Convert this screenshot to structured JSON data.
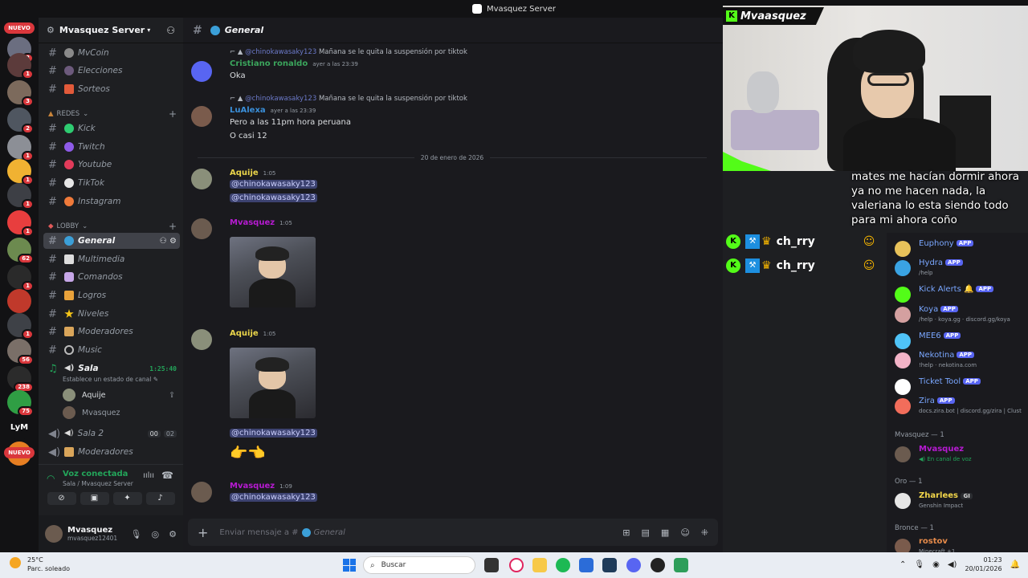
{
  "window_title": "Mvasquez Server",
  "rail": {
    "nuevo_top": "NUEVO",
    "nuevo_bottom": "NUEVO",
    "badges": [
      "3",
      "1",
      "3",
      "2",
      "1",
      "1",
      "1",
      "1",
      "62",
      "1",
      "1",
      "56",
      "238",
      "75"
    ],
    "lym_label": "LyM"
  },
  "server": {
    "name": "Mvasquez Server"
  },
  "channels_top": [
    {
      "name": "MvCoin"
    },
    {
      "name": "Elecciones"
    },
    {
      "name": "Sorteos"
    }
  ],
  "cat_redes": "REDES",
  "channels_redes": [
    {
      "name": "Kick"
    },
    {
      "name": "Twitch"
    },
    {
      "name": "Youtube"
    },
    {
      "name": "TikTok"
    },
    {
      "name": "Instagram"
    }
  ],
  "cat_lobby": "LOBBY",
  "channels_lobby": [
    {
      "name": "General"
    },
    {
      "name": "Multimedia"
    },
    {
      "name": "Comandos"
    },
    {
      "name": "Logros"
    },
    {
      "name": "Niveles"
    },
    {
      "name": "Moderadores"
    },
    {
      "name": "Music"
    }
  ],
  "voice_sala": {
    "name": "Sala",
    "time": "1:25:40",
    "status_hint": "Establece un estado de canal",
    "users": [
      "Aquije",
      "Mvasquez"
    ]
  },
  "voice_sala2": {
    "name": "Sala 2",
    "count_a": "00",
    "count_b": "02"
  },
  "voice_mods": {
    "name": "Moderadores"
  },
  "voice_connected": {
    "title": "Voz conectada",
    "sub": "Sala / Mvasquez Server"
  },
  "user": {
    "name": "Mvasquez",
    "tag": "mvasquez12401"
  },
  "chat": {
    "channel": "General",
    "date_divider": "20 de enero de 2026",
    "composer_placeholder": "Enviar mensaje a #",
    "composer_channel": "General",
    "messages": [
      {
        "reply_mention": "@chinokawasaky123",
        "reply_text": "Mañana se le quita la suspensión por tiktok",
        "author": "Cristiano ronaldo",
        "time": "ayer a las 23:39",
        "lines": [
          "Oka"
        ]
      },
      {
        "reply_mention": "@chinokawasaky123",
        "reply_text": "Mañana se le quita la suspensión por tiktok",
        "author": "LuAlexa",
        "time": "ayer a las 23:39",
        "lines": [
          "Pero a las 11pm hora peruana",
          "O casi 12"
        ]
      },
      {
        "author": "Aquije",
        "time": "1:05",
        "mentions": [
          "@chinokawasaky123",
          "@chinokawasaky123"
        ]
      },
      {
        "author": "Mvasquez",
        "time": "1:05"
      },
      {
        "author": "Aquije",
        "time": "1:05",
        "mention": "@chinokawasaky123"
      },
      {
        "author": "Mvasquez",
        "time": "1:09",
        "mention": "@chinokawasaky123"
      }
    ]
  },
  "stream": {
    "streamer": "Mvaasquez",
    "subtitle": "mates me hacían dormir ahora ya no me hacen nada, la valeriana lo esta siendo todo para mi ahora coño",
    "chat_user": "ch_rry"
  },
  "members": {
    "apps": [
      {
        "name": "Euphony",
        "sub": "",
        "color": "#e8c25a"
      },
      {
        "name": "Hydra",
        "sub": "/help",
        "color": "#3aa3e3"
      },
      {
        "name": "Kick Alerts",
        "sub": "",
        "color": "#53fc18"
      },
      {
        "name": "Koya",
        "sub": "/help · koya.gg · discord.gg/koya",
        "color": "#d4a0a0"
      },
      {
        "name": "MEE6",
        "sub": "",
        "color": "#4fc3f7"
      },
      {
        "name": "Nekotina",
        "sub": "!help · nekotina.com",
        "color": "#f3b3c7"
      },
      {
        "name": "Ticket Tool",
        "sub": "",
        "color": "#ffffff"
      },
      {
        "name": "Zira",
        "sub": "docs.zira.bot | discord.gg/zira | Clust",
        "color": "#f26d5b"
      }
    ],
    "app_badge": "APP",
    "group_mvasquez": "Mvasquez — 1",
    "mvasquez": {
      "name": "Mvasquez",
      "sub": "En canal de voz"
    },
    "group_oro": "Oro — 1",
    "zharlees": {
      "name": "Zharlees",
      "tag": "GI",
      "sub": "Genshin Impact"
    },
    "group_bronce": "Bronce — 1",
    "rostov": {
      "name": "rostov",
      "sub": "Minecraft +1"
    }
  },
  "taskbar": {
    "temp": "25°C",
    "weather": "Parc. soleado",
    "search": "Buscar",
    "time": "01:23",
    "date": "20/01/2026"
  }
}
